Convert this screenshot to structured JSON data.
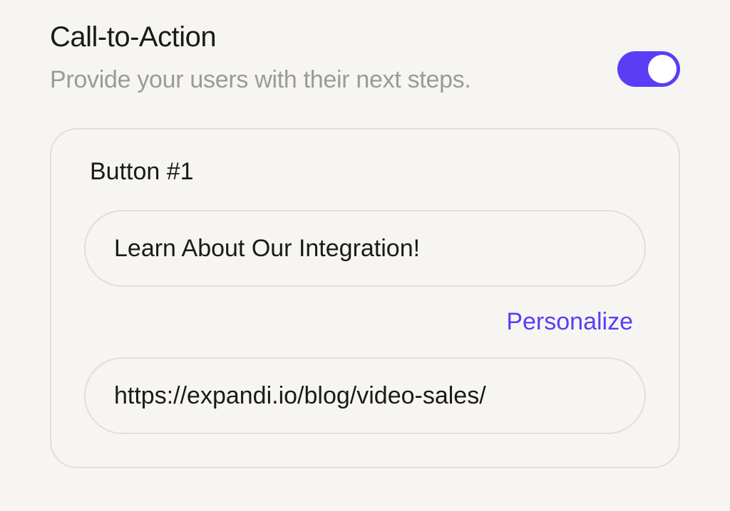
{
  "section": {
    "title": "Call-to-Action",
    "subtitle": "Provide your users with their next steps.",
    "toggle_on": true
  },
  "button1": {
    "label": "Button #1",
    "text_value": "Learn About Our Integration!",
    "url_value": "https://expandi.io/blog/video-sales/",
    "personalize_label": "Personalize"
  },
  "colors": {
    "accent": "#5b3df5",
    "background": "#f7f5f2",
    "border": "#e2ded9",
    "text_primary": "#1a1a1a",
    "text_muted": "#9a9a9a"
  }
}
